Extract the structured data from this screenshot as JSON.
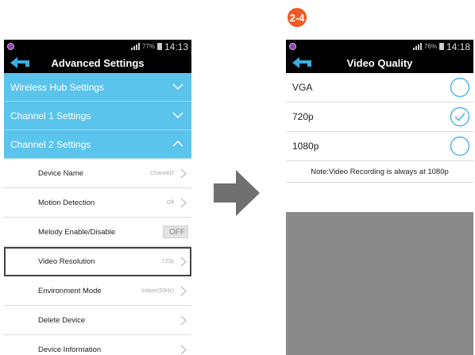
{
  "step_badge": "2-4",
  "colors": {
    "section_blue": "#5bc4ec",
    "radio_blue": "#4db8e8",
    "badge_orange": "#ee5a24",
    "gray_area": "#8a8a8a"
  },
  "left_phone": {
    "status": {
      "battery_pct": "77%",
      "time": "14:13"
    },
    "title": "Advanced Settings",
    "back_icon": "back-arrow-icon",
    "sections": [
      {
        "label": "Wireless Hub Settings",
        "state": "collapsed"
      },
      {
        "label": "Channel 1 Settings",
        "state": "collapsed"
      },
      {
        "label": "Channel 2 Settings",
        "state": "expanded"
      }
    ],
    "items": [
      {
        "label": "Device Name",
        "value": "Channel2"
      },
      {
        "label": "Motion Detection",
        "value": "Off"
      },
      {
        "label": "Melody Enable/Disable",
        "toggle": "OFF"
      },
      {
        "label": "Video Resolution",
        "value": "720p",
        "highlighted": true
      },
      {
        "label": "Environment Mode",
        "value": "Indoor(50Hz)"
      },
      {
        "label": "Delete Device",
        "value": ""
      },
      {
        "label": "Device Information",
        "value": ""
      }
    ]
  },
  "right_phone": {
    "status": {
      "battery_pct": "76%",
      "time": "14:18"
    },
    "title": "Video Quality",
    "back_icon": "back-arrow-icon",
    "options": [
      {
        "label": "VGA",
        "selected": false
      },
      {
        "label": "720p",
        "selected": true
      },
      {
        "label": "1080p",
        "selected": false
      }
    ],
    "note": "Note:Video Recording is always at 1080p"
  }
}
